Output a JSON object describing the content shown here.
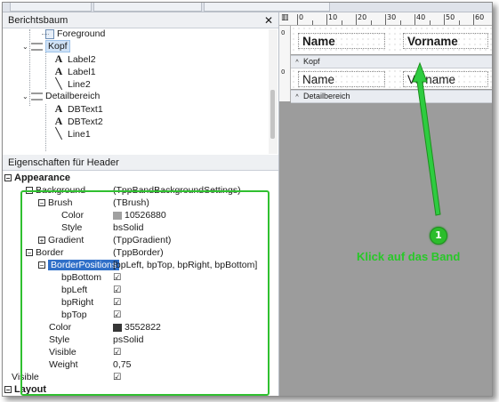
{
  "tree_panel": {
    "title": "Berichtsbaum",
    "close": "✕",
    "nodes": [
      {
        "label": "Foreground"
      },
      {
        "label": "Kopf"
      },
      {
        "label": "Label2"
      },
      {
        "label": "Label1"
      },
      {
        "label": "Line2"
      },
      {
        "label": "Detailbereich"
      },
      {
        "label": "DBText1"
      },
      {
        "label": "DBText2"
      },
      {
        "label": "Line1"
      }
    ]
  },
  "properties_panel": {
    "title": "Eigenschaften für Header",
    "appearance": "Appearance",
    "rows": [
      {
        "name": "Background",
        "value": "(TppBandBackgroundSettings)"
      },
      {
        "name": "Brush",
        "value": "(TBrush)"
      },
      {
        "name": "Color",
        "value": "10526880",
        "swatch": "#a0a0a0"
      },
      {
        "name": "Style",
        "value": "bsSolid"
      },
      {
        "name": "Gradient",
        "value": "(TppGradient)"
      },
      {
        "name": "Border",
        "value": "(TppBorder)"
      },
      {
        "name": "BorderPositions",
        "value": "[bpLeft, bpTop, bpRight, bpBottom]"
      },
      {
        "name": "bpBottom",
        "value": "☑"
      },
      {
        "name": "bpLeft",
        "value": "☑"
      },
      {
        "name": "bpRight",
        "value": "☑"
      },
      {
        "name": "bpTop",
        "value": "☑"
      },
      {
        "name": "Color",
        "value": "3552822",
        "swatch": "#363636"
      },
      {
        "name": "Style",
        "value": "psSolid"
      },
      {
        "name": "Visible",
        "value": "☑"
      },
      {
        "name": "Weight",
        "value": "0,75"
      },
      {
        "name": "Visible",
        "value": "☑"
      }
    ],
    "layout": "Layout"
  },
  "designer": {
    "ruler_labels": [
      "0",
      "10",
      "20",
      "30",
      "40",
      "50",
      "60"
    ],
    "v_label": "0",
    "header_band": {
      "field1": "Name",
      "field2": "Vorname",
      "bar_label": "Kopf"
    },
    "detail_band": {
      "field1": "Name",
      "field2": "Vorname",
      "bar_label": "Detailbereich"
    }
  },
  "annotation": {
    "number": "1",
    "text": "Klick auf das Band",
    "color": "#28c828"
  }
}
